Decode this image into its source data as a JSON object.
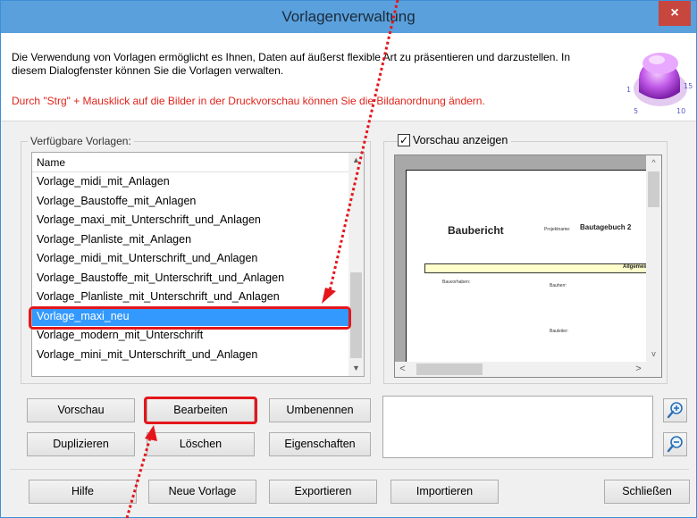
{
  "window": {
    "title": "Vorlagenverwaltung",
    "close_glyph": "×"
  },
  "header": {
    "description": "Die Verwendung von Vorlagen ermöglicht es Ihnen, Daten auf äußerst flexible Art zu präsentieren und darzustellen. In diesem Dialogfenster können Sie die Vorlagen verwalten.",
    "warning": "Durch \"Strg\" + Mausklick auf die Bilder in der Druckvorschau können Sie die Bildanordnung ändern.",
    "knob_icon": "purple-dial-icon",
    "knob_numbers": [
      "1",
      "5",
      "10",
      "15"
    ]
  },
  "templates": {
    "label": "Verfügbare Vorlagen:",
    "column_header": "Name",
    "items": [
      "Vorlage_midi_mit_Anlagen",
      "Vorlage_Baustoffe_mit_Anlagen",
      "Vorlage_maxi_mit_Unterschrift_und_Anlagen",
      "Vorlage_Planliste_mit_Anlagen",
      "Vorlage_midi_mit_Unterschrift_und_Anlagen",
      "Vorlage_Baustoffe_mit_Unterschrift_und_Anlagen",
      "Vorlage_Planliste_mit_Unterschrift_und_Anlagen",
      "Vorlage_maxi_neu",
      "Vorlage_modern_mit_Unterschrift",
      "Vorlage_mini_mit_Unterschrift_und_Anlagen"
    ],
    "selected_index": 7
  },
  "preview": {
    "checkbox_label": "Vorschau anzeigen",
    "checked": true,
    "doc": {
      "title": "Baubericht",
      "project_label": "Projektname:",
      "project_value": "Bautagebuch 2",
      "band_text": "Allgemeine",
      "field_bauvorhaben": "Bauvorhaben:",
      "field_bauherr": "Bauherr:",
      "field_bauleiter": "Bauleiter:"
    }
  },
  "buttons": {
    "vorschau": "Vorschau",
    "bearbeiten": "Bearbeiten",
    "umbenennen": "Umbenennen",
    "duplizieren": "Duplizieren",
    "loeschen": "Löschen",
    "eigenschaften": "Eigenschaften",
    "hilfe": "Hilfe",
    "neue_vorlage": "Neue Vorlage",
    "exportieren": "Exportieren",
    "importieren": "Importieren",
    "schliessen": "Schließen"
  },
  "colors": {
    "accent_red": "#e4161b",
    "selection": "#3399ff",
    "titlebar": "#5aa0dc"
  }
}
